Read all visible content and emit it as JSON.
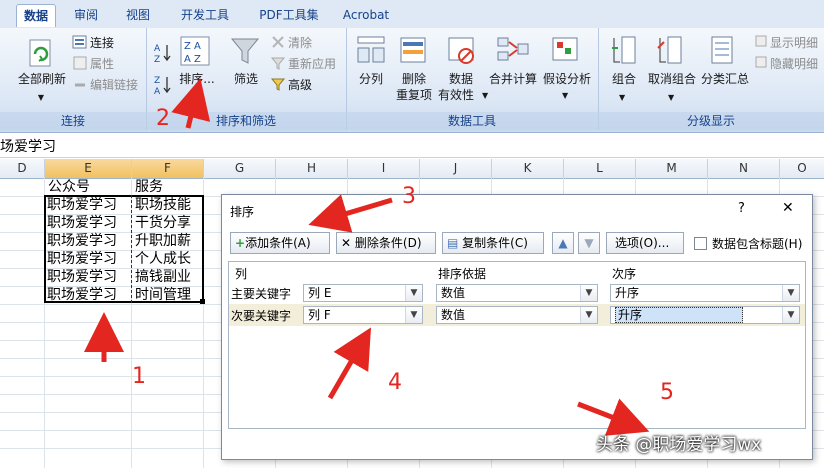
{
  "ribbon": {
    "tabs": [
      "数据",
      "审阅",
      "视图",
      "开发工具",
      "PDF工具集",
      "Acrobat"
    ],
    "active_tab": "数据",
    "groups": {
      "connections": {
        "label": "连接",
        "refresh_all": "全部刷新",
        "connections": "连接",
        "properties": "属性",
        "edit_links": "编辑链接"
      },
      "sort_filter": {
        "label": "排序和筛选",
        "sort": "排序...",
        "filter": "筛选",
        "clear": "清除",
        "reapply": "重新应用",
        "advanced": "高级"
      },
      "data_tools": {
        "label": "数据工具",
        "text_to_columns": "分列",
        "remove_dup_1": "删除",
        "remove_dup_2": "重复项",
        "validation_1": "数据",
        "validation_2": "有效性",
        "consolidate": "合并计算",
        "what_if": "假设分析"
      },
      "outline": {
        "label": "分级显示",
        "group": "组合",
        "ungroup": "取消组合",
        "subtotal": "分类汇总",
        "show_detail": "显示明细",
        "hide_detail": "隐藏明细"
      }
    }
  },
  "formula_bar": {
    "value": "场爱学习"
  },
  "sheet": {
    "columns": [
      "D",
      "E",
      "F",
      "G",
      "H",
      "I",
      "J",
      "K",
      "L",
      "M",
      "N",
      "O"
    ],
    "header_row": [
      "公众号",
      "服务"
    ],
    "rows": [
      [
        "职场爱学习",
        "职场技能"
      ],
      [
        "职场爱学习",
        "干货分享"
      ],
      [
        "职场爱学习",
        "升职加薪"
      ],
      [
        "职场爱学习",
        "个人成长"
      ],
      [
        "职场爱学习",
        "搞钱副业"
      ],
      [
        "职场爱学习",
        "时间管理"
      ]
    ]
  },
  "dialog": {
    "title": "排序",
    "help": "?",
    "close": "✕",
    "add_condition": "添加条件(A)",
    "delete_condition": "删除条件(D)",
    "copy_condition": "复制条件(C)",
    "options": "选项(O)...",
    "has_header": "数据包含标题(H)",
    "col_header": "列",
    "sort_on_header": "排序依据",
    "order_header": "次序",
    "levels": [
      {
        "label": "主要关键字",
        "column": "列 E",
        "sort_on": "数值",
        "order": "升序"
      },
      {
        "label": "次要关键字",
        "column": "列 F",
        "sort_on": "数值",
        "order": "升序"
      }
    ]
  },
  "annotations": [
    "1",
    "2",
    "3",
    "4",
    "5"
  ],
  "watermark": "头条 @职场爱学习wx",
  "colors": {
    "accent": "#15428b",
    "arrow": "#e3261f",
    "selection": "#f1c15f"
  }
}
